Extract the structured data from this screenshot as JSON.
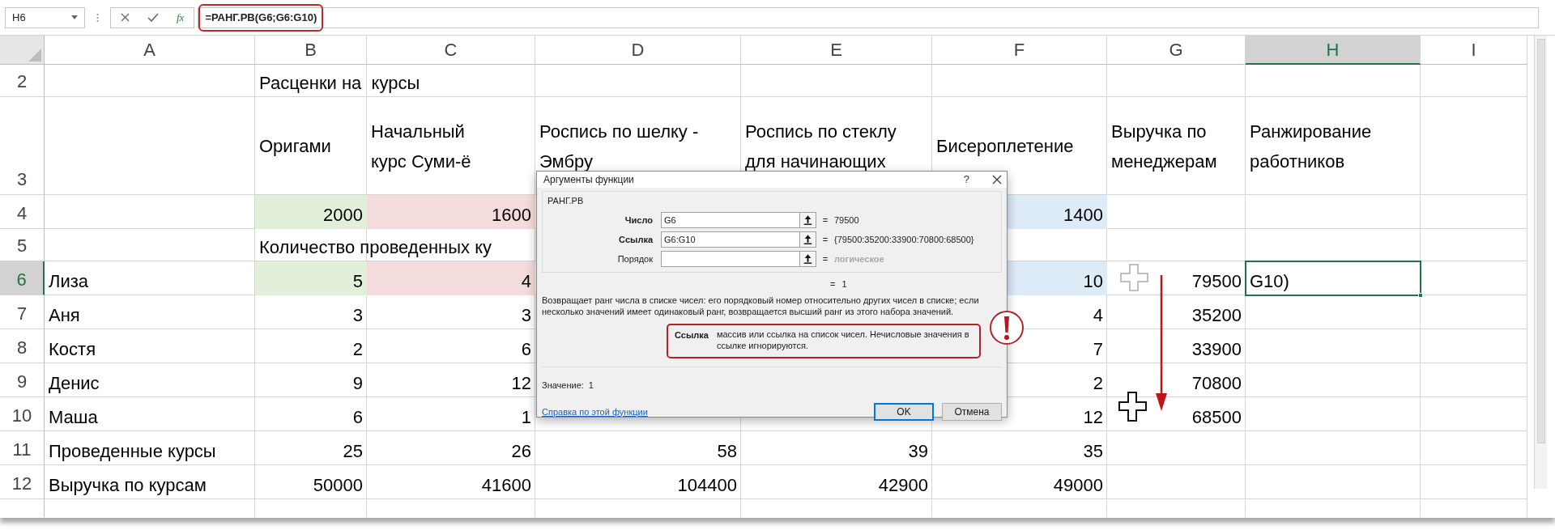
{
  "name_box": "H6",
  "formula": "=РАНГ.РВ(G6;G6:G10)",
  "fx": "fx",
  "columns": [
    {
      "label": "A",
      "selected": false
    },
    {
      "label": "B",
      "selected": false
    },
    {
      "label": "C",
      "selected": false
    },
    {
      "label": "D",
      "selected": false
    },
    {
      "label": "E",
      "selected": false
    },
    {
      "label": "F",
      "selected": false
    },
    {
      "label": "G",
      "selected": false
    },
    {
      "label": "H",
      "selected": true
    },
    {
      "label": "I",
      "selected": false
    }
  ],
  "rows": [
    {
      "number": "2",
      "kind": "title",
      "selected": false,
      "cells": [
        {},
        {
          "text": "Расценки на  курсы",
          "kind": "text"
        },
        {},
        {},
        {},
        {},
        {},
        {},
        {}
      ]
    },
    {
      "number": "3",
      "kind": "header",
      "selected": false,
      "cells": [
        {},
        {
          "text": "Оригами",
          "kind": "text"
        },
        {
          "text": "Начальный\nкурс Суми-ё",
          "kind": "text"
        },
        {
          "text": "Роспись по шелку - Эмбру",
          "kind": "text"
        },
        {
          "text": "Роспись по стеклу для начинающих",
          "kind": "text"
        },
        {
          "text": "Бисероплетение",
          "kind": "text"
        },
        {
          "text": "Выручка по менеджерам",
          "kind": "text"
        },
        {
          "text": "Ранжирование работников",
          "kind": "text"
        },
        {}
      ]
    },
    {
      "number": "4",
      "kind": "data",
      "selected": false,
      "cells": [
        {},
        {
          "text": "2000",
          "kind": "number",
          "color": "#e2efda"
        },
        {
          "text": "1600",
          "kind": "number",
          "color": "#f4dcdc"
        },
        {},
        {},
        {
          "text": "1400",
          "kind": "number",
          "color": "#ddebf7"
        },
        {},
        {},
        {}
      ]
    },
    {
      "number": "5",
      "kind": "title",
      "selected": false,
      "cells": [
        {},
        {
          "text": "Количество проведенных ку",
          "kind": "text"
        },
        {},
        {},
        {},
        {},
        {},
        {},
        {}
      ]
    },
    {
      "number": "6",
      "kind": "data",
      "selected": true,
      "cells": [
        {
          "text": "Лиза",
          "kind": "text"
        },
        {
          "text": "5",
          "kind": "number",
          "color": "#e2efda"
        },
        {
          "text": "4",
          "kind": "number",
          "color": "#f4dcdc"
        },
        {},
        {},
        {
          "text": "10",
          "kind": "number",
          "color": "#ddebf7"
        },
        {
          "text": "79500",
          "kind": "number"
        },
        {
          "text": "G10)",
          "kind": "text"
        },
        {}
      ]
    },
    {
      "number": "7",
      "kind": "data",
      "selected": false,
      "cells": [
        {
          "text": "Аня",
          "kind": "text"
        },
        {
          "text": "3",
          "kind": "number"
        },
        {
          "text": "3",
          "kind": "number"
        },
        {},
        {},
        {
          "text": "4",
          "kind": "number"
        },
        {
          "text": "35200",
          "kind": "number"
        },
        {},
        {}
      ]
    },
    {
      "number": "8",
      "kind": "data",
      "selected": false,
      "cells": [
        {
          "text": "Костя",
          "kind": "text"
        },
        {
          "text": "2",
          "kind": "number"
        },
        {
          "text": "6",
          "kind": "number"
        },
        {},
        {},
        {
          "text": "7",
          "kind": "number"
        },
        {
          "text": "33900",
          "kind": "number"
        },
        {},
        {}
      ]
    },
    {
      "number": "9",
      "kind": "data",
      "selected": false,
      "cells": [
        {
          "text": "Денис",
          "kind": "text"
        },
        {
          "text": "9",
          "kind": "number"
        },
        {
          "text": "12",
          "kind": "number"
        },
        {},
        {},
        {
          "text": "2",
          "kind": "number"
        },
        {
          "text": "70800",
          "kind": "number"
        },
        {},
        {}
      ]
    },
    {
      "number": "10",
      "kind": "data",
      "selected": false,
      "cells": [
        {
          "text": "Маша",
          "kind": "text"
        },
        {
          "text": "6",
          "kind": "number"
        },
        {
          "text": "1",
          "kind": "number"
        },
        {},
        {},
        {
          "text": "12",
          "kind": "number"
        },
        {
          "text": "68500",
          "kind": "number"
        },
        {},
        {}
      ]
    },
    {
      "number": "11",
      "kind": "data",
      "selected": false,
      "cells": [
        {
          "text": "Проведенные курсы",
          "kind": "text"
        },
        {
          "text": "25",
          "kind": "number"
        },
        {
          "text": "26",
          "kind": "number"
        },
        {
          "text": "58",
          "kind": "number"
        },
        {
          "text": "39",
          "kind": "number"
        },
        {
          "text": "35",
          "kind": "number"
        },
        {},
        {},
        {}
      ]
    },
    {
      "number": "12",
      "kind": "data",
      "selected": false,
      "cells": [
        {
          "text": "Выручка по курсам",
          "kind": "text"
        },
        {
          "text": "50000",
          "kind": "number"
        },
        {
          "text": "41600",
          "kind": "number"
        },
        {
          "text": "104400",
          "kind": "number"
        },
        {
          "text": "42900",
          "kind": "number"
        },
        {
          "text": "49000",
          "kind": "number"
        },
        {},
        {},
        {}
      ]
    }
  ],
  "dialog": {
    "title": "Аргументы функции",
    "help": "?",
    "function_name": "РАНГ.РВ",
    "arguments": [
      {
        "label": "Число",
        "value": "G6",
        "equals": "=",
        "result": "79500",
        "required": true
      },
      {
        "label": "Ссылка",
        "value": "G6:G10",
        "equals": "=",
        "result": "{79500:35200:33900:70800:68500}",
        "required": true
      },
      {
        "label": "Порядок",
        "equals": "=",
        "result": "логическое",
        "required": false
      }
    ],
    "formula_result": {
      "equals": "=",
      "value": "1"
    },
    "description": "Возвращает ранг числа в списке чисел: его порядковый номер относительно других чисел в списке; если несколько значений имеет одинаковый ранг, возвращается высший ранг из этого набора значений.",
    "argument_help": {
      "name": "Ссылка",
      "text": "массив или ссылка на список чисел. Нечисловые значения в ссылке игнорируются."
    },
    "value_label": "Значение:",
    "value": "1",
    "help_link": "Справка по этой функции",
    "buttons": [
      {
        "label": "OK",
        "default": true
      },
      {
        "label": "Отмена",
        "default": false
      }
    ]
  }
}
